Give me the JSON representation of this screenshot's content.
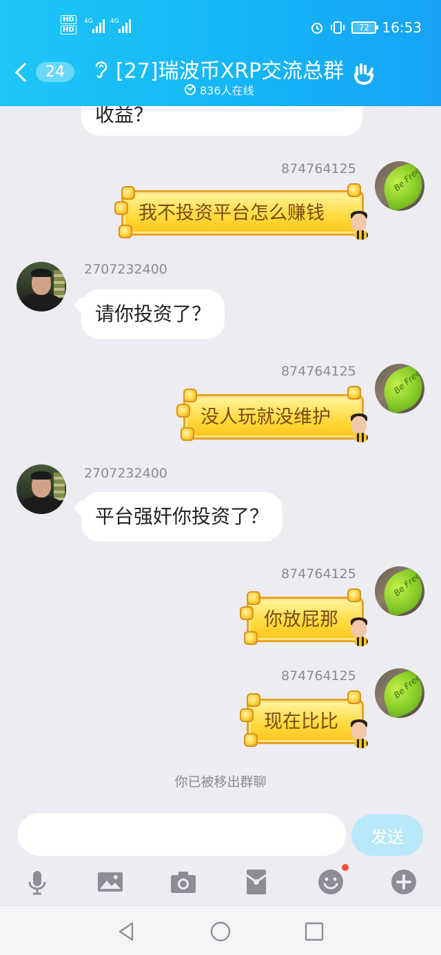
{
  "status_bar": {
    "hd1": "HD",
    "hd2": "HD",
    "net1": "4G",
    "net2": "4G",
    "battery": "72",
    "time": "16:53"
  },
  "header": {
    "unread_count": "24",
    "group_title": "[27]瑞波币XRP交流总群",
    "online_text": "836人在线"
  },
  "messages": [
    {
      "side": "left",
      "sender": "",
      "text": "收益？"
    },
    {
      "side": "right",
      "sender": "874764125",
      "text": "我不投资平台怎么赚钱"
    },
    {
      "side": "left",
      "sender": "2707232400",
      "text": "请你投资了？"
    },
    {
      "side": "right",
      "sender": "874764125",
      "text": "没人玩就没维护"
    },
    {
      "side": "left",
      "sender": "2707232400",
      "text": "平台强奸你投资了？"
    },
    {
      "side": "right",
      "sender": "874764125",
      "text": "你放屁那"
    },
    {
      "side": "right",
      "sender": "874764125",
      "text": "现在比比"
    }
  ],
  "avatar_leaf_text": "Be Free",
  "system_note": "你已被移出群聊",
  "input": {
    "placeholder": "",
    "send_label": "发送"
  },
  "toolbar_icons": [
    "microphone-icon",
    "image-icon",
    "camera-icon",
    "red-packet-icon",
    "emoji-icon",
    "plus-icon"
  ],
  "colors": {
    "header_start": "#1ec6f7",
    "header_end": "#17a3f5",
    "chat_bg": "#ececf2",
    "send_button": "#b9e8fb",
    "bubble_gold": "#ffd93b"
  }
}
